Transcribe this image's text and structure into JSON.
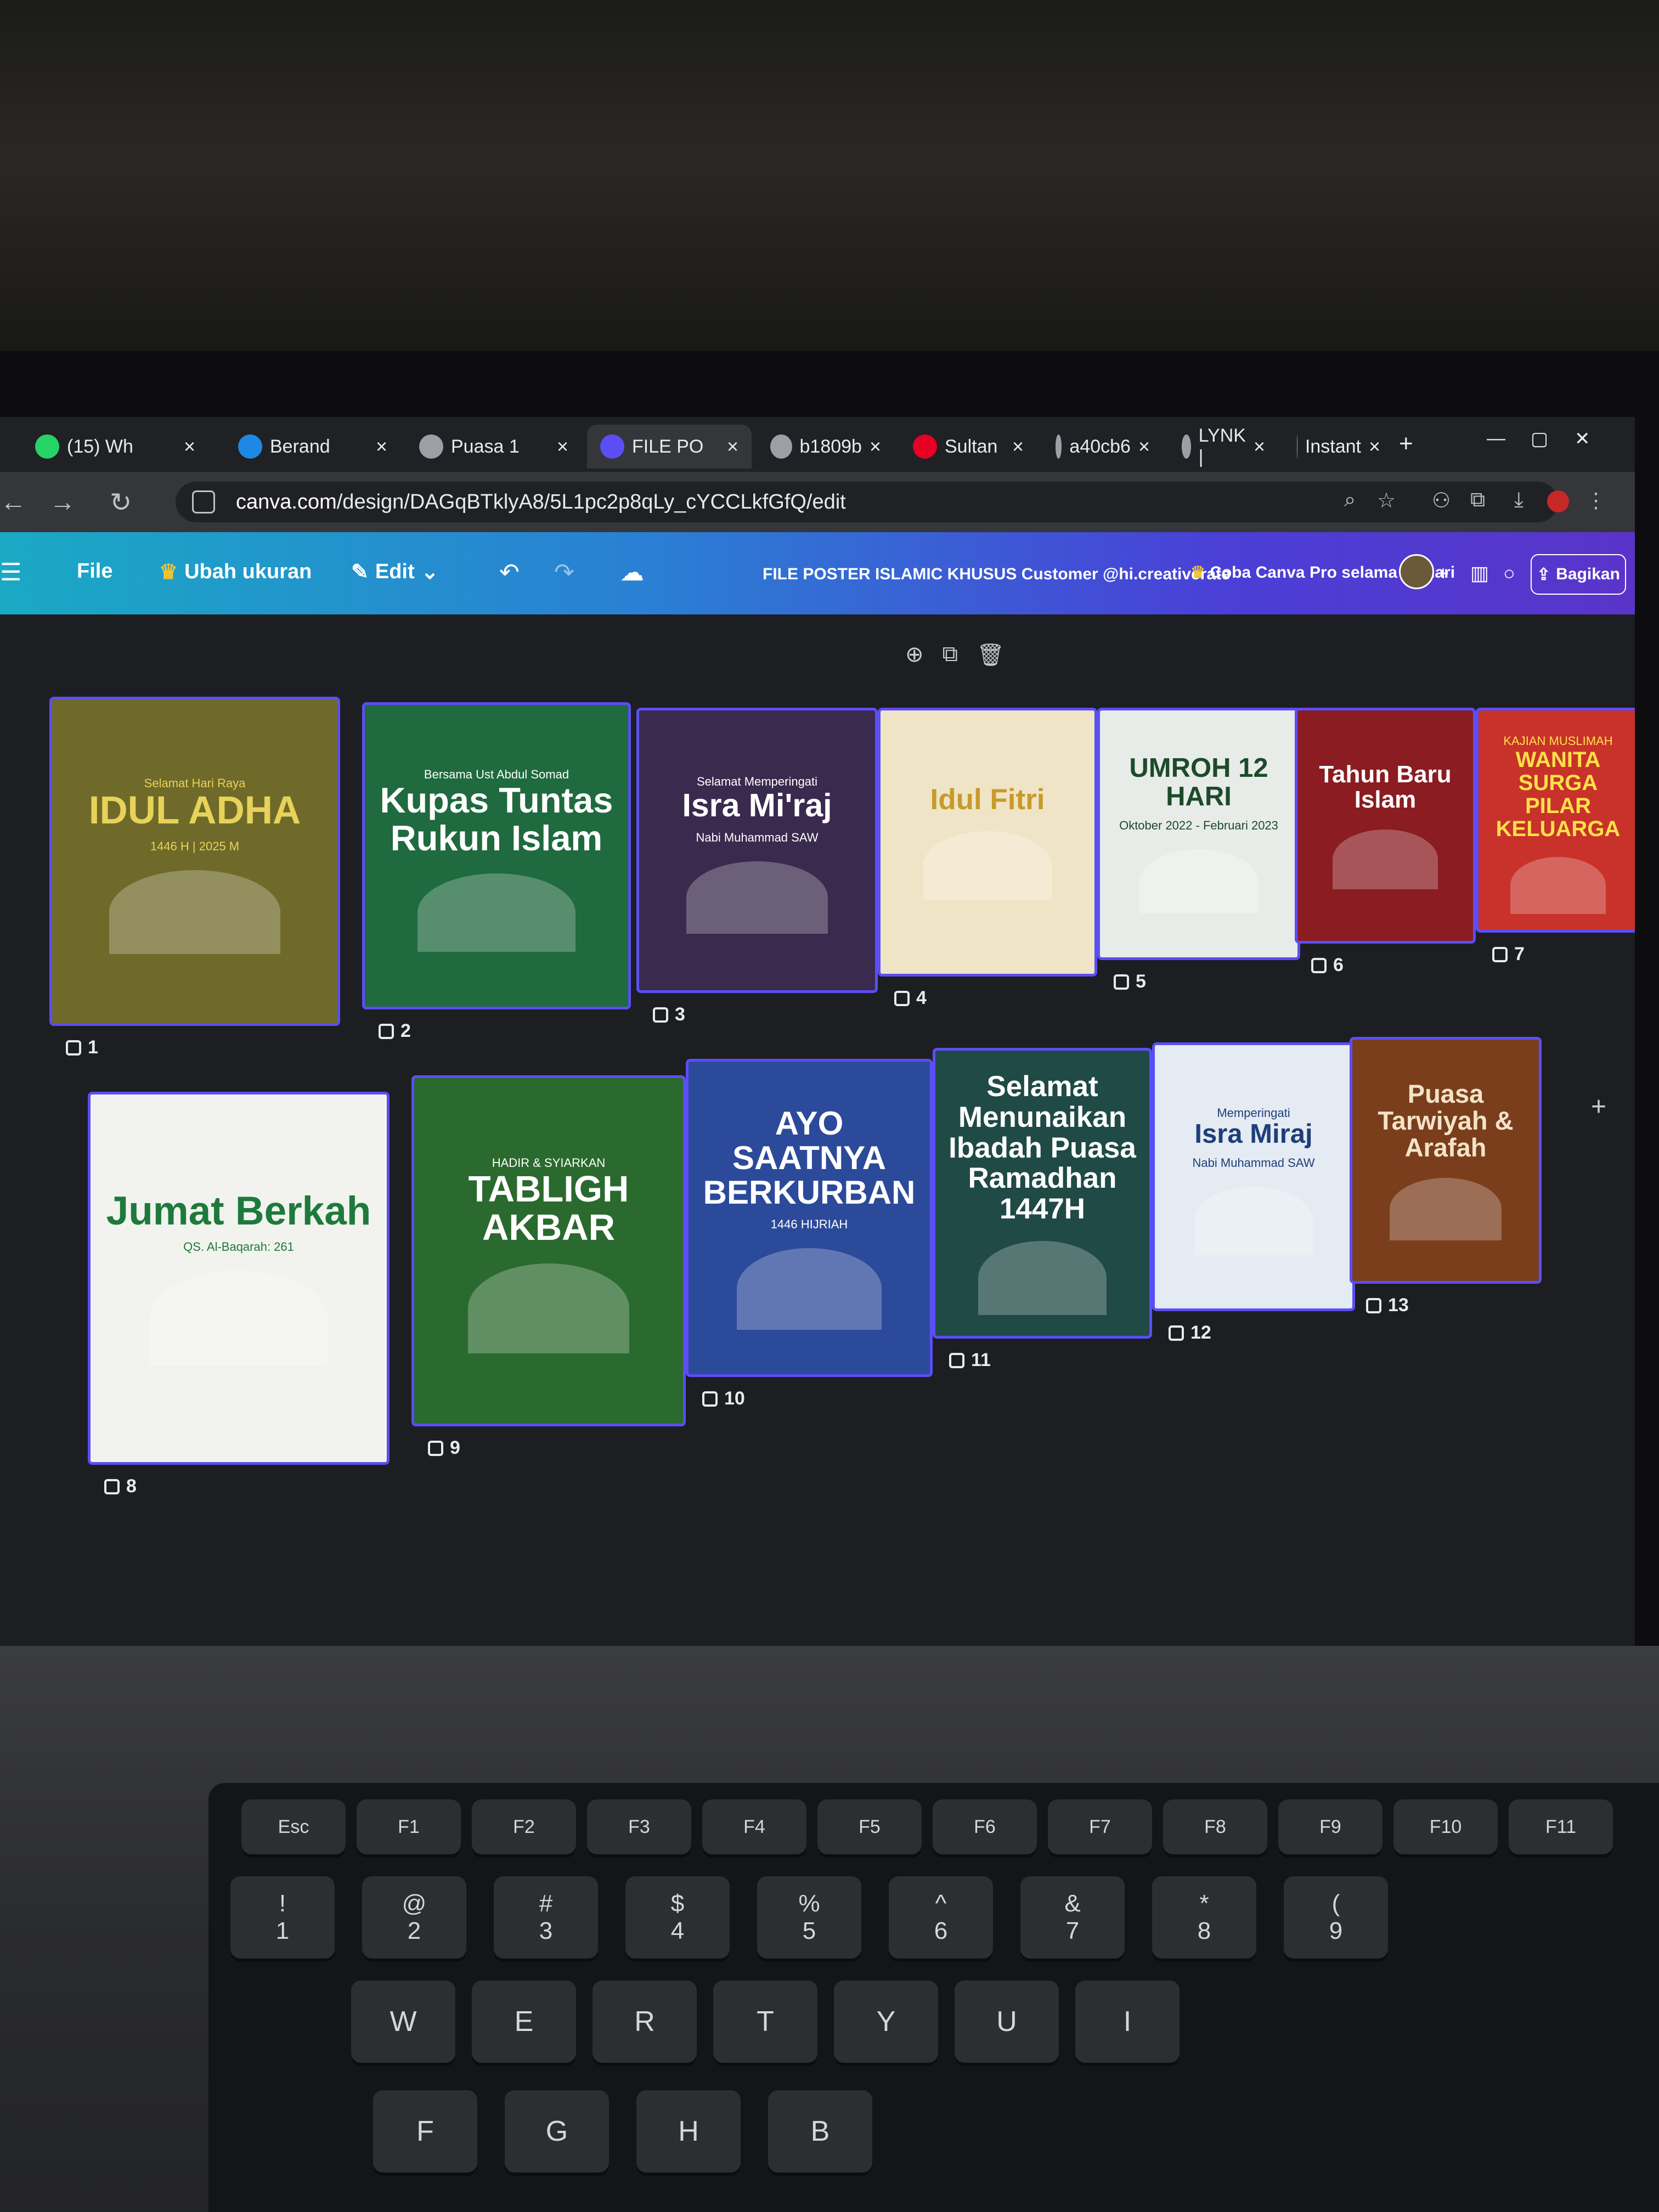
{
  "browser": {
    "tabs": [
      {
        "label": "(15) Wh",
        "icon": "whatsapp-icon",
        "color": "#25d366"
      },
      {
        "label": "Berand",
        "icon": "canva-icon",
        "color": "#1e88e5"
      },
      {
        "label": "Puasa 1",
        "icon": "gear-icon",
        "color": "#9aa0a6"
      },
      {
        "label": "FILE PO",
        "icon": "canva-icon",
        "color": "#5b4ef5",
        "active": true
      },
      {
        "label": "b1809b",
        "icon": "gear-icon",
        "color": "#9aa0a6"
      },
      {
        "label": "Sultan",
        "icon": "pinterest-icon",
        "color": "#e60023"
      },
      {
        "label": "a40cb6",
        "icon": "gear-icon",
        "color": "#9aa0a6"
      },
      {
        "label": "LYNK |",
        "icon": "lynk-icon",
        "color": "#9aa0a6"
      },
      {
        "label": "Instant",
        "icon": "instant-icon",
        "color": "#9aa0a6"
      }
    ],
    "url_host": "canva.com",
    "url_path": "/design/DAGqBTklyA8/5L1pc2p8qLy_cYCCLkfGfQ/edit"
  },
  "toolbar": {
    "file_label": "File",
    "resize_label": "Ubah ukuran",
    "edit_label": "Edit",
    "doc_title": "FILE POSTER ISLAMIC KHUSUS Customer @hi.creativerate",
    "pro_label": "Coba Canva Pro selama 30 hari",
    "share_label": "Bagikan"
  },
  "pages": [
    {
      "num": "1",
      "title": "IDUL ADHA",
      "top": "Selamat Hari Raya",
      "sub": "1446 H | 2025 M",
      "bg": "#6f6a2a",
      "fg": "#e7d25a"
    },
    {
      "num": "2",
      "title": "Kupas Tuntas Rukun Islam",
      "top": "Bersama Ust Abdul Somad",
      "sub": "",
      "bg": "#1f6a3e",
      "fg": "#ffffff"
    },
    {
      "num": "3",
      "title": "Isra Mi'raj",
      "top": "Selamat Memperingati",
      "sub": "Nabi Muhammad SAW",
      "bg": "#3a2a4e",
      "fg": "#ffffff"
    },
    {
      "num": "4",
      "title": "Idul Fitri",
      "top": "",
      "sub": "",
      "bg": "#efe4c6",
      "fg": "#c79a2a"
    },
    {
      "num": "5",
      "title": "UMROH 12 HARI",
      "top": "",
      "sub": "Oktober 2022 - Februari 2023",
      "bg": "#e8ece8",
      "fg": "#1d4a2c"
    },
    {
      "num": "6",
      "title": "Tahun Baru Islam",
      "top": "",
      "sub": "",
      "bg": "#8a1c22",
      "fg": "#ffffff"
    },
    {
      "num": "7",
      "title": "WANITA SURGA PILAR KELUARGA",
      "top": "KAJIAN MUSLIMAH",
      "sub": "",
      "bg": "#c8322a",
      "fg": "#ffe04a"
    },
    {
      "num": "8",
      "title": "Jumat Berkah",
      "top": "",
      "sub": "QS. Al-Baqarah: 261",
      "bg": "#f2f3ee",
      "fg": "#1e7a3c"
    },
    {
      "num": "9",
      "title": "TABLIGH AKBAR",
      "top": "HADIR & SYIARKAN",
      "sub": "",
      "bg": "#2a6a2e",
      "fg": "#ffffff"
    },
    {
      "num": "10",
      "title": "AYO SAATNYA BERKURBAN",
      "top": "",
      "sub": "1446 HIJRIAH",
      "bg": "#2c4a9a",
      "fg": "#ffffff"
    },
    {
      "num": "11",
      "title": "Selamat Menunaikan Ibadah Puasa Ramadhan 1447H",
      "top": "",
      "sub": "",
      "bg": "#1f4a46",
      "fg": "#ffffff"
    },
    {
      "num": "12",
      "title": "Isra Miraj",
      "top": "Memperingati",
      "sub": "Nabi Muhammad SAW",
      "bg": "#e4ebf2",
      "fg": "#1f3f7a"
    },
    {
      "num": "13",
      "title": "Puasa Tarwiyah & Arafah",
      "top": "",
      "sub": "",
      "bg": "#7a3e1c",
      "fg": "#f3e3c8"
    }
  ],
  "keyboard": {
    "keys": [
      "Esc",
      "F1",
      "F2",
      "F3",
      "F4",
      "F5",
      "F6",
      "F7",
      "F8",
      "F9",
      "F10",
      "F11",
      "!",
      "1",
      "@",
      "2",
      "#",
      "3",
      "$",
      "4",
      "%",
      "5",
      "^",
      "6",
      "&",
      "7",
      "*",
      "8",
      "(",
      "9",
      "W",
      "E",
      "R",
      "T",
      "Y",
      "U",
      "I",
      "F",
      "G",
      "H",
      "B"
    ]
  }
}
